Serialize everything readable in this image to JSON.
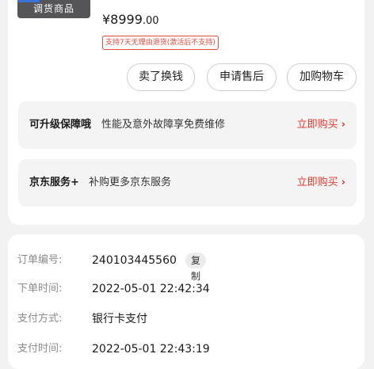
{
  "product": {
    "badge": "调货商品",
    "price_main": "¥8999",
    "price_cents": ".00",
    "return_policy": "支持7天无理由退货(激活后不支持)"
  },
  "actions": {
    "sell_trade": "卖了换钱",
    "after_sale": "申请售后",
    "add_cart": "加购物车"
  },
  "services": [
    {
      "label": "可升级保障哦",
      "desc": "性能及意外故障享免费维修",
      "buy": "立即购买"
    },
    {
      "label": "京东服务+",
      "desc": "补购更多京东服务",
      "buy": "立即购买"
    }
  ],
  "order_info": {
    "order_no_label": "订单编号:",
    "order_no": "240103445560",
    "copy_label": "复制",
    "order_time_label": "下单时间:",
    "order_time": "2022-05-01 22:42:34",
    "pay_method_label": "支付方式:",
    "pay_method": "银行卡支付",
    "pay_time_label": "支付时间:",
    "pay_time": "2022-05-01 22:43:19"
  },
  "colors": {
    "accent_red": "#e2392c",
    "card_bg": "#ffffff",
    "page_bg": "#f2f2f2"
  }
}
